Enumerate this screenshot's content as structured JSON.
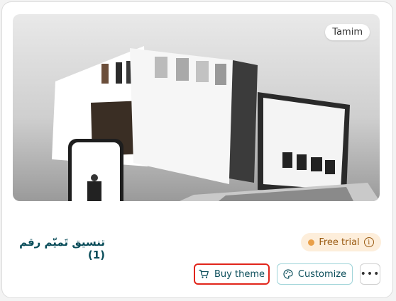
{
  "card": {
    "vendor_badge": "Tamim",
    "title": "تنسيق تَميّم رقم (1)",
    "trial_label": "Free trial",
    "buy_label": "Buy theme",
    "customize_label": "Customize",
    "more_label": "•••",
    "accent_color": "#0a4d5a",
    "trial_bg": "#fdeedb",
    "highlight_color": "#e1251b"
  }
}
